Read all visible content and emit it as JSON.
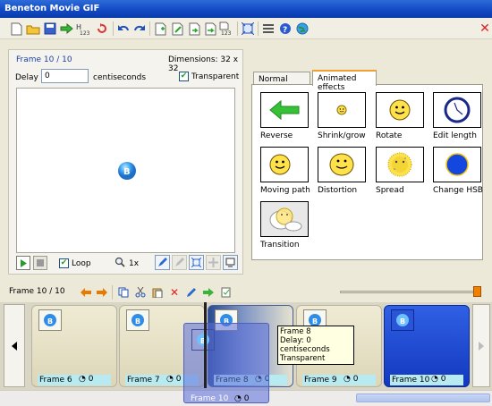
{
  "window": {
    "title": "Beneton Movie GIF"
  },
  "toolbar": {
    "icons": [
      "new-file-icon",
      "open-folder-icon",
      "save-icon",
      "export-icon",
      "renumber-icon",
      "revert-icon",
      "undo-icon",
      "redo-icon",
      "new-frame-icon",
      "edit-frame-icon",
      "import-frame-icon",
      "export-frame-icon",
      "number-frames-icon",
      "resize-icon",
      "properties-icon",
      "help-icon",
      "web-icon"
    ],
    "renumber_badge": "123",
    "number_badge": "123",
    "close_glyph": "✕"
  },
  "frame_panel": {
    "title": "Frame 10 / 10",
    "dimensions": "Dimensions: 32 x 32",
    "delay_label": "Delay",
    "delay_value": "0",
    "delay_unit": "centiseconds",
    "transparent_label": "Transparent",
    "transparent_checked": true,
    "loop_label": "Loop",
    "loop_checked": true,
    "zoom_label": "1x"
  },
  "tabs": [
    {
      "label": "Normal effects",
      "active": false
    },
    {
      "label": "Animated effects",
      "active": true
    }
  ],
  "effects": [
    {
      "label": "Reverse",
      "icon": "green-arrow-left-icon"
    },
    {
      "label": "Shrink/grow",
      "icon": "small-smiley-icon"
    },
    {
      "label": "Rotate",
      "icon": "smiley-icon"
    },
    {
      "label": "Edit length",
      "icon": "clock-icon"
    },
    {
      "label": "Moving path",
      "icon": "smiley-icon"
    },
    {
      "label": "Distortion",
      "icon": "smiley-icon"
    },
    {
      "label": "Spread",
      "icon": "spread-smiley-icon"
    },
    {
      "label": "Change HSB",
      "icon": "blue-circle-icon"
    },
    {
      "label": "Transition",
      "icon": "transition-icon"
    }
  ],
  "frames_bar": {
    "count": "Frame 10 / 10"
  },
  "frames": [
    {
      "label": "Frame 6",
      "delay": "0"
    },
    {
      "label": "Frame 7",
      "delay": "0"
    },
    {
      "label": "Frame 8",
      "delay": "0"
    },
    {
      "label": "Frame 9",
      "delay": "0"
    },
    {
      "label": "Frame 10",
      "delay": "0"
    }
  ],
  "drag_ghost": {
    "label": "Frame 10",
    "delay": "0"
  },
  "tooltip": {
    "line1": "Frame 8",
    "line2": "Delay: 0 centiseconds",
    "line3": "Transparent"
  },
  "colors": {
    "title_bar": "#1148c2",
    "selected_frame": "#1a3fc8",
    "slider_thumb": "#f08000",
    "accent_tab": "#f0a030"
  }
}
